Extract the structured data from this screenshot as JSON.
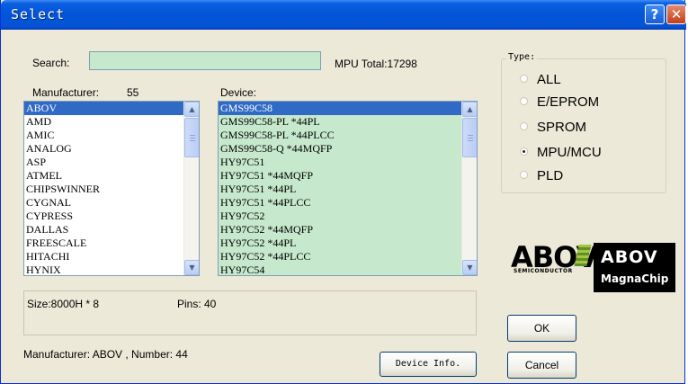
{
  "window": {
    "title": "Select",
    "help_icon": "?",
    "close_icon": "✕"
  },
  "search": {
    "label": "Search:",
    "value": "",
    "total": "MPU Total:17298"
  },
  "manufacturer": {
    "label": "Manufacturer:",
    "count": "55",
    "items": [
      "ABOV",
      "AMD",
      "AMIC",
      "ANALOG",
      "ASP",
      "ATMEL",
      "CHIPSWINNER",
      "CYGNAL",
      "CYPRESS",
      "DALLAS",
      "FREESCALE",
      "HITACHI",
      "HYNIX"
    ],
    "selected": "ABOV"
  },
  "device": {
    "label": "Device:",
    "items": [
      "GMS99C58",
      "GMS99C58-PL *44PL",
      "GMS99C58-PL *44PLCC",
      "GMS99C58-Q *44MQFP",
      "HY97C51",
      "HY97C51 *44MQFP",
      "HY97C51 *44PL",
      "HY97C51 *44PLCC",
      "HY97C52",
      "HY97C52 *44MQFP",
      "HY97C52 *44PL",
      "HY97C52 *44PLCC",
      "HY97C54"
    ],
    "selected": "GMS99C58"
  },
  "type": {
    "legend": "Type:",
    "options": [
      "ALL",
      "E/EPROM",
      "SPROM",
      "MPU/MCU",
      "PLD"
    ],
    "selected": "MPU/MCU"
  },
  "logos": {
    "abov_left": "ABOV",
    "abov_left_sub": "SEMICONDUCTOR",
    "abov_right": "ABOV",
    "magnachip": "MagnaChip"
  },
  "info": {
    "size": "Size:8000H * 8",
    "pins": "Pins: 40"
  },
  "status": "Manufacturer: ABOV , Number: 44",
  "buttons": {
    "device_info": "Device Info.",
    "ok": "OK",
    "cancel": "Cancel"
  },
  "icons": {
    "scroll_up": "▲",
    "scroll_down": "▼"
  },
  "colors": {
    "title_bar": "#0454d8",
    "selection": "#316ac5",
    "device_bg": "#c6e8cc",
    "dialog_bg": "#ece9d8"
  }
}
